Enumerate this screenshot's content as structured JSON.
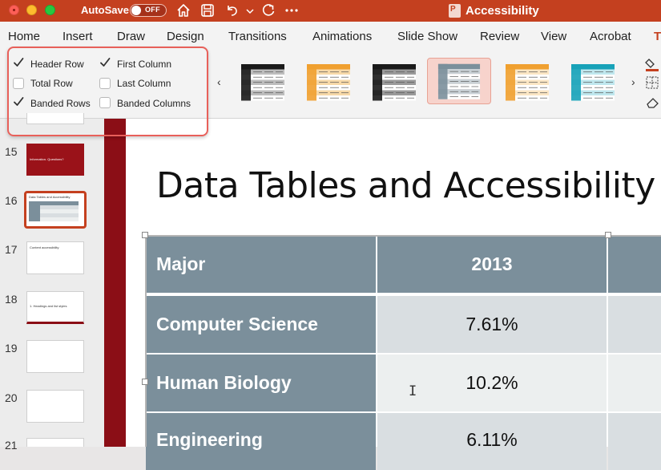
{
  "titlebar": {
    "autosave_label": "AutoSave",
    "autosave_state": "OFF",
    "document_title": "Accessibility"
  },
  "ribbon_tabs": [
    {
      "label": "Home"
    },
    {
      "label": "Insert"
    },
    {
      "label": "Draw"
    },
    {
      "label": "Design"
    },
    {
      "label": "Transitions"
    },
    {
      "label": "Animations"
    },
    {
      "label": "Slide Show"
    },
    {
      "label": "Review"
    },
    {
      "label": "View"
    },
    {
      "label": "Acrobat"
    },
    {
      "label": "T"
    }
  ],
  "table_style_options": {
    "header_row": {
      "label": "Header Row",
      "checked": true
    },
    "first_column": {
      "label": "First Column",
      "checked": true
    },
    "total_row": {
      "label": "Total Row",
      "checked": false
    },
    "last_column": {
      "label": "Last Column",
      "checked": false
    },
    "banded_rows": {
      "label": "Banded Rows",
      "checked": true
    },
    "banded_columns": {
      "label": "Banded Columns",
      "checked": false
    }
  },
  "table_styles": [
    {
      "name": "style-black",
      "accent": "#1a1a1a",
      "band": "#bdbdbd"
    },
    {
      "name": "style-orange",
      "accent": "#f0a030",
      "band": "#f7d9a8"
    },
    {
      "name": "style-black-dark",
      "accent": "#1a1a1a",
      "band": "#9a9a9a"
    },
    {
      "name": "style-gray-selected",
      "accent": "#7b8f9b",
      "band": "#c9d1d6"
    },
    {
      "name": "style-orange-first-col",
      "accent": "#f0a030",
      "band": "#fbe6c4"
    },
    {
      "name": "style-teal",
      "accent": "#17a2b8",
      "band": "#bfe7ee"
    }
  ],
  "slides": [
    {
      "number": "15",
      "title": "Information. Questions?"
    },
    {
      "number": "16",
      "title": "Data Tables and Accessibility",
      "selected": true
    },
    {
      "number": "17",
      "title": "Content accessibility"
    },
    {
      "number": "18",
      "title": "1. Headings and list styles"
    },
    {
      "number": "19",
      "title": ""
    },
    {
      "number": "20",
      "title": ""
    },
    {
      "number": "21",
      "title": ""
    }
  ],
  "slide": {
    "title": "Data Tables and Accessibility",
    "table": {
      "headers": [
        "Major",
        "2013"
      ],
      "rows": [
        [
          "Computer Science",
          "7.61%"
        ],
        [
          "Human Biology",
          "10.2%"
        ],
        [
          "Engineering",
          "6.11%"
        ]
      ]
    }
  },
  "colors": {
    "brand": "#c4401f",
    "table_header": "#7b8f9b",
    "highlight_border": "#e8605a"
  }
}
